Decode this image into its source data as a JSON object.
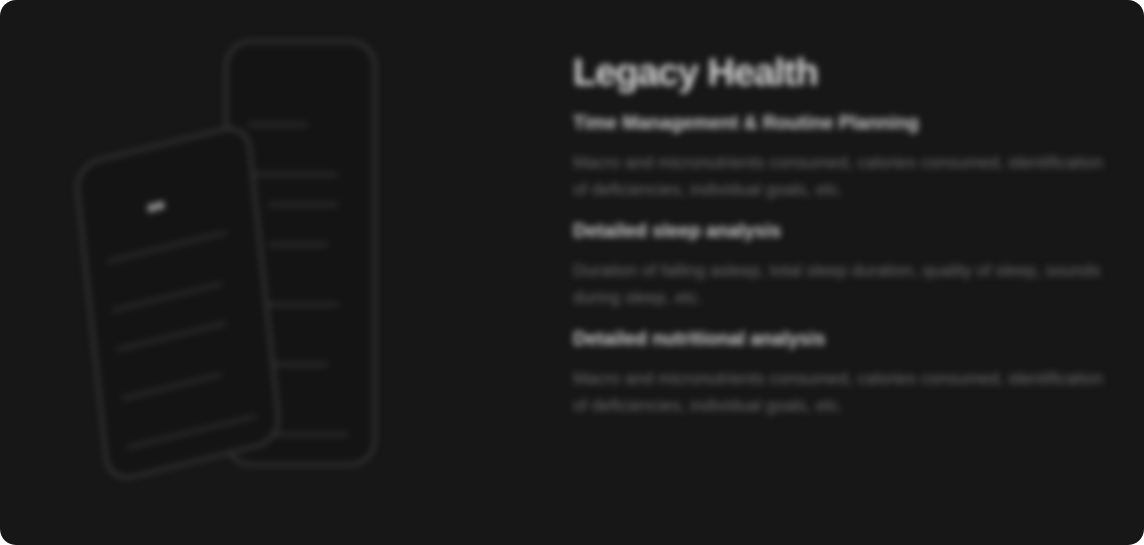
{
  "title": "Legacy Health",
  "colors": {
    "background": "#171717",
    "heading": "#d8d8d8",
    "body_text": "#6c6c6c"
  },
  "sections": [
    {
      "heading": "Time Management & Routine Planning",
      "text": "Macro and micronutrients consumed, calories consumed, identification of deficiencies, individual goals, etc."
    },
    {
      "heading": "Detailed sleep analysis",
      "text": "Duration of falling asleep, total sleep duration, quality of sleep, sounds during sleep, etc."
    },
    {
      "heading": "Detailed nutritional analysis",
      "text": "Macro and micronutrients consumed, calories consumed, identification of deficiencies, individual goals, etc."
    }
  ]
}
